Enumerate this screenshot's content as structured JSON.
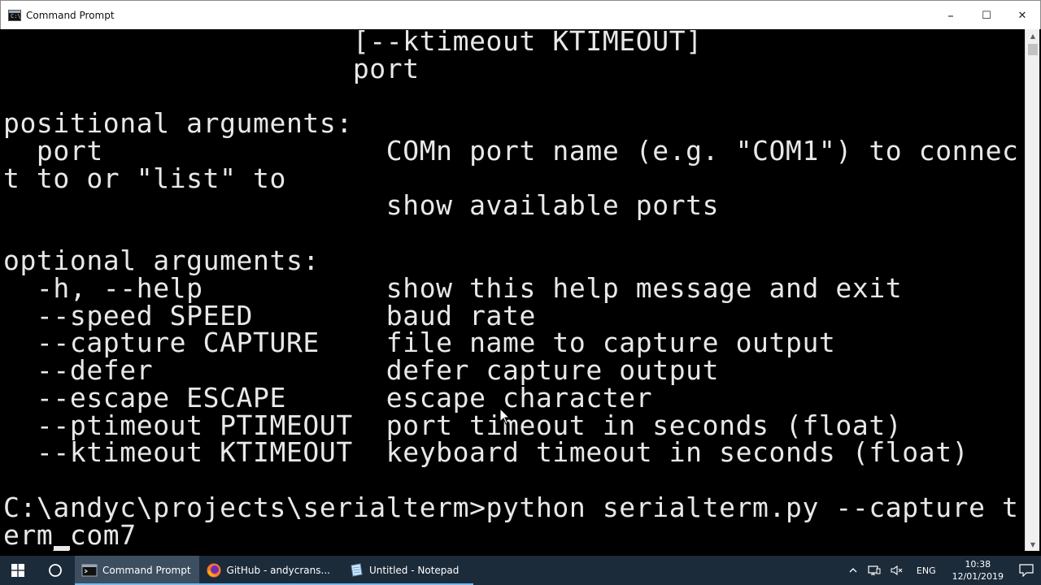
{
  "window": {
    "title": "Command Prompt",
    "minimize": "–",
    "maximize": "☐",
    "close": "✕"
  },
  "console": {
    "lines": [
      "                     [--ktimeout KTIMEOUT]",
      "                     port",
      "",
      "positional arguments:",
      "  port                 COMn port name (e.g. \"COM1\") to connec",
      "t to or \"list\" to",
      "                       show available ports",
      "",
      "optional arguments:",
      "  -h, --help           show this help message and exit",
      "  --speed SPEED        baud rate",
      "  --capture CAPTURE    file name to capture output",
      "  --defer              defer capture output",
      "  --escape ESCAPE      escape character",
      "  --ptimeout PTIMEOUT  port timeout in seconds (float)",
      "  --ktimeout KTIMEOUT  keyboard timeout in seconds (float)",
      "",
      "C:\\andyc\\projects\\serialterm>python serialterm.py --capture t",
      "erm_com7"
    ]
  },
  "taskbar": {
    "apps": [
      {
        "label": "Command Prompt",
        "icon": "command-prompt-icon",
        "active": true
      },
      {
        "label": "GitHub - andycrans...",
        "icon": "firefox-icon",
        "active": false
      },
      {
        "label": "Untitled - Notepad",
        "icon": "notepad-icon",
        "active": false
      }
    ],
    "tray": {
      "language": "ENG",
      "time": "10:38",
      "date": "12/01/2019"
    }
  },
  "colors": {
    "console_bg": "#000000",
    "console_fg": "#e8e8e8",
    "taskbar_bg": "#1c2b3a",
    "taskbar_active": "#3d4e60",
    "accent": "#76b9ed"
  }
}
